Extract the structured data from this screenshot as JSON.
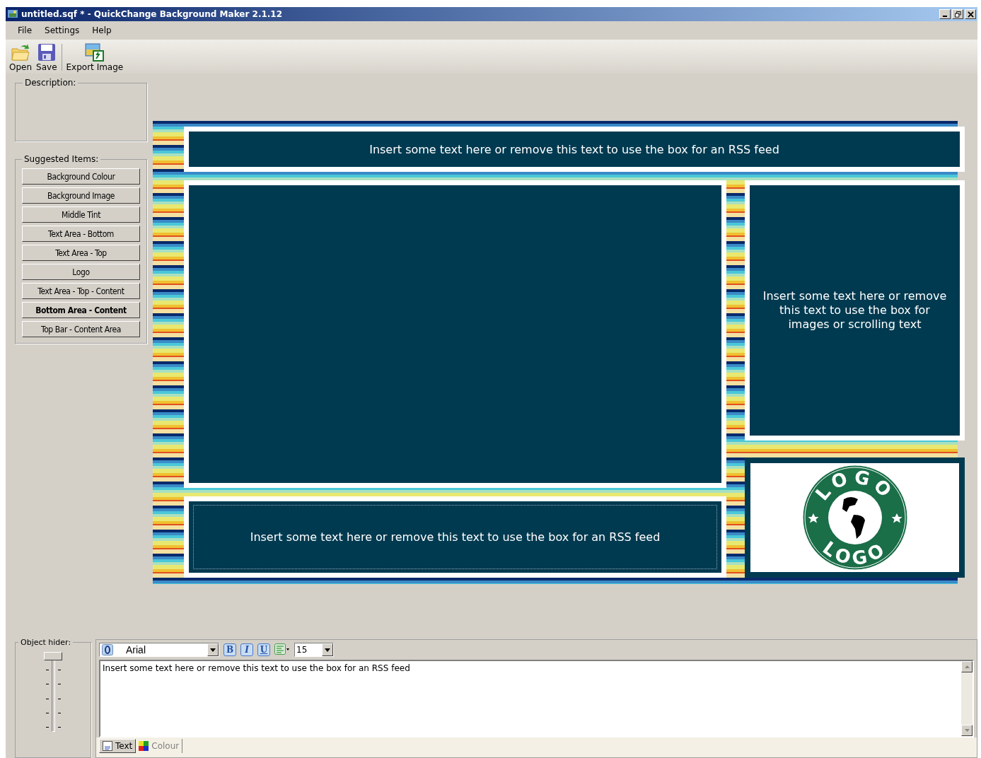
{
  "window": {
    "title": "untitled.sqf * - QuickChange Background Maker 2.1.12"
  },
  "menu": [
    "File",
    "Settings",
    "Help"
  ],
  "toolbar": [
    {
      "kind": "open",
      "label": "Open"
    },
    {
      "kind": "save",
      "label": "Save"
    },
    {
      "kind": "export",
      "label": "Export Image"
    }
  ],
  "description": {
    "legend": "Description:"
  },
  "suggested_items": {
    "legend": "Suggested Items:",
    "items": [
      {
        "label": "Background Colour",
        "selected": false
      },
      {
        "label": "Background Image",
        "selected": false
      },
      {
        "label": "Middle Tint",
        "selected": false
      },
      {
        "label": "Text Area - Bottom",
        "selected": false
      },
      {
        "label": "Text Area - Top",
        "selected": false
      },
      {
        "label": "Logo",
        "selected": false
      },
      {
        "label": "Text Area - Top - Content",
        "selected": false
      },
      {
        "label": "Bottom Area - Content",
        "selected": true
      },
      {
        "label": "Top Bar - Content Area",
        "selected": false
      }
    ]
  },
  "preview": {
    "top_bar_text": "Insert some text here or remove this text to use the box for an RSS feed",
    "side_text": "Insert some text here or remove this text to use the box for images or scrolling text",
    "bottom_text": "Insert some text here or remove this text to use the box for an RSS feed",
    "logo": {
      "top": "LOGO",
      "bottom": "LOGO"
    }
  },
  "object_hider": {
    "legend": "Object hider:",
    "level": 1
  },
  "editor": {
    "font": "Arial",
    "format_buttons": [
      {
        "kind": "bold",
        "label": "B"
      },
      {
        "kind": "italic",
        "label": "I"
      },
      {
        "kind": "underline",
        "label": "U"
      }
    ],
    "size": "15",
    "text": "Insert some text here or remove this text to use the box for an RSS feed",
    "tabs": [
      {
        "label": "Text",
        "selected": true
      },
      {
        "label": "Colour",
        "selected": false
      }
    ]
  }
}
